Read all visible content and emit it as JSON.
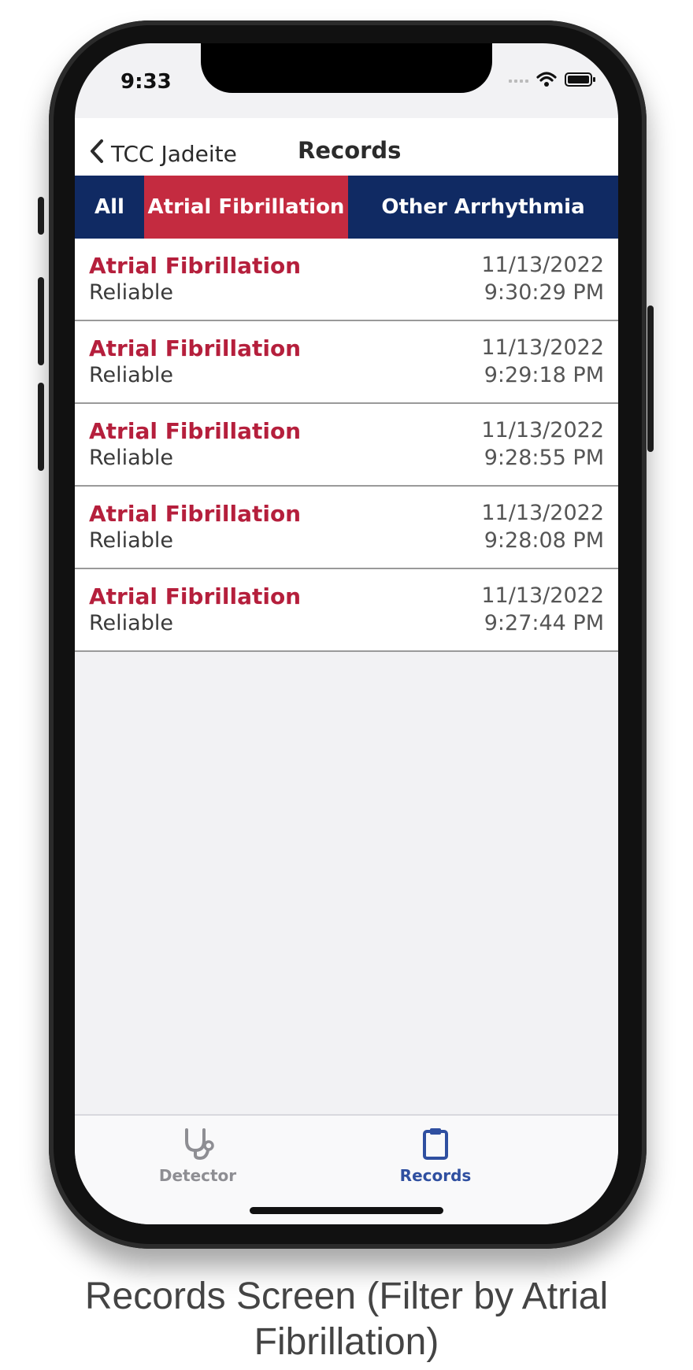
{
  "status_bar": {
    "time": "9:33",
    "icons": [
      "cellular-icon",
      "wifi-icon",
      "battery-icon"
    ]
  },
  "nav": {
    "back_label": "TCC Jadeite",
    "title": "Records"
  },
  "filter_tabs": [
    {
      "label": "All",
      "active": false
    },
    {
      "label": "Atrial Fibrillation",
      "active": true
    },
    {
      "label": "Other Arrhythmia",
      "active": false
    }
  ],
  "records": [
    {
      "title": "Atrial Fibrillation",
      "status": "Reliable",
      "date": "11/13/2022",
      "time": "9:30:29 PM"
    },
    {
      "title": "Atrial Fibrillation",
      "status": "Reliable",
      "date": "11/13/2022",
      "time": "9:29:18 PM"
    },
    {
      "title": "Atrial Fibrillation",
      "status": "Reliable",
      "date": "11/13/2022",
      "time": "9:28:55 PM"
    },
    {
      "title": "Atrial Fibrillation",
      "status": "Reliable",
      "date": "11/13/2022",
      "time": "9:28:08 PM"
    },
    {
      "title": "Atrial Fibrillation",
      "status": "Reliable",
      "date": "11/13/2022",
      "time": "9:27:44 PM"
    }
  ],
  "tab_bar": {
    "detector": {
      "label": "Detector",
      "icon": "stethoscope-icon",
      "active": false
    },
    "records": {
      "label": "Records",
      "icon": "clipboard-icon",
      "active": true
    }
  },
  "colors": {
    "navy": "#102a63",
    "accent_red": "#c42b40",
    "title_red": "#b51f3c",
    "active_tab_blue": "#2f4fa0",
    "inactive_gray": "#8e8e93"
  },
  "caption": "Records Screen (Filter by Atrial Fibrillation)"
}
